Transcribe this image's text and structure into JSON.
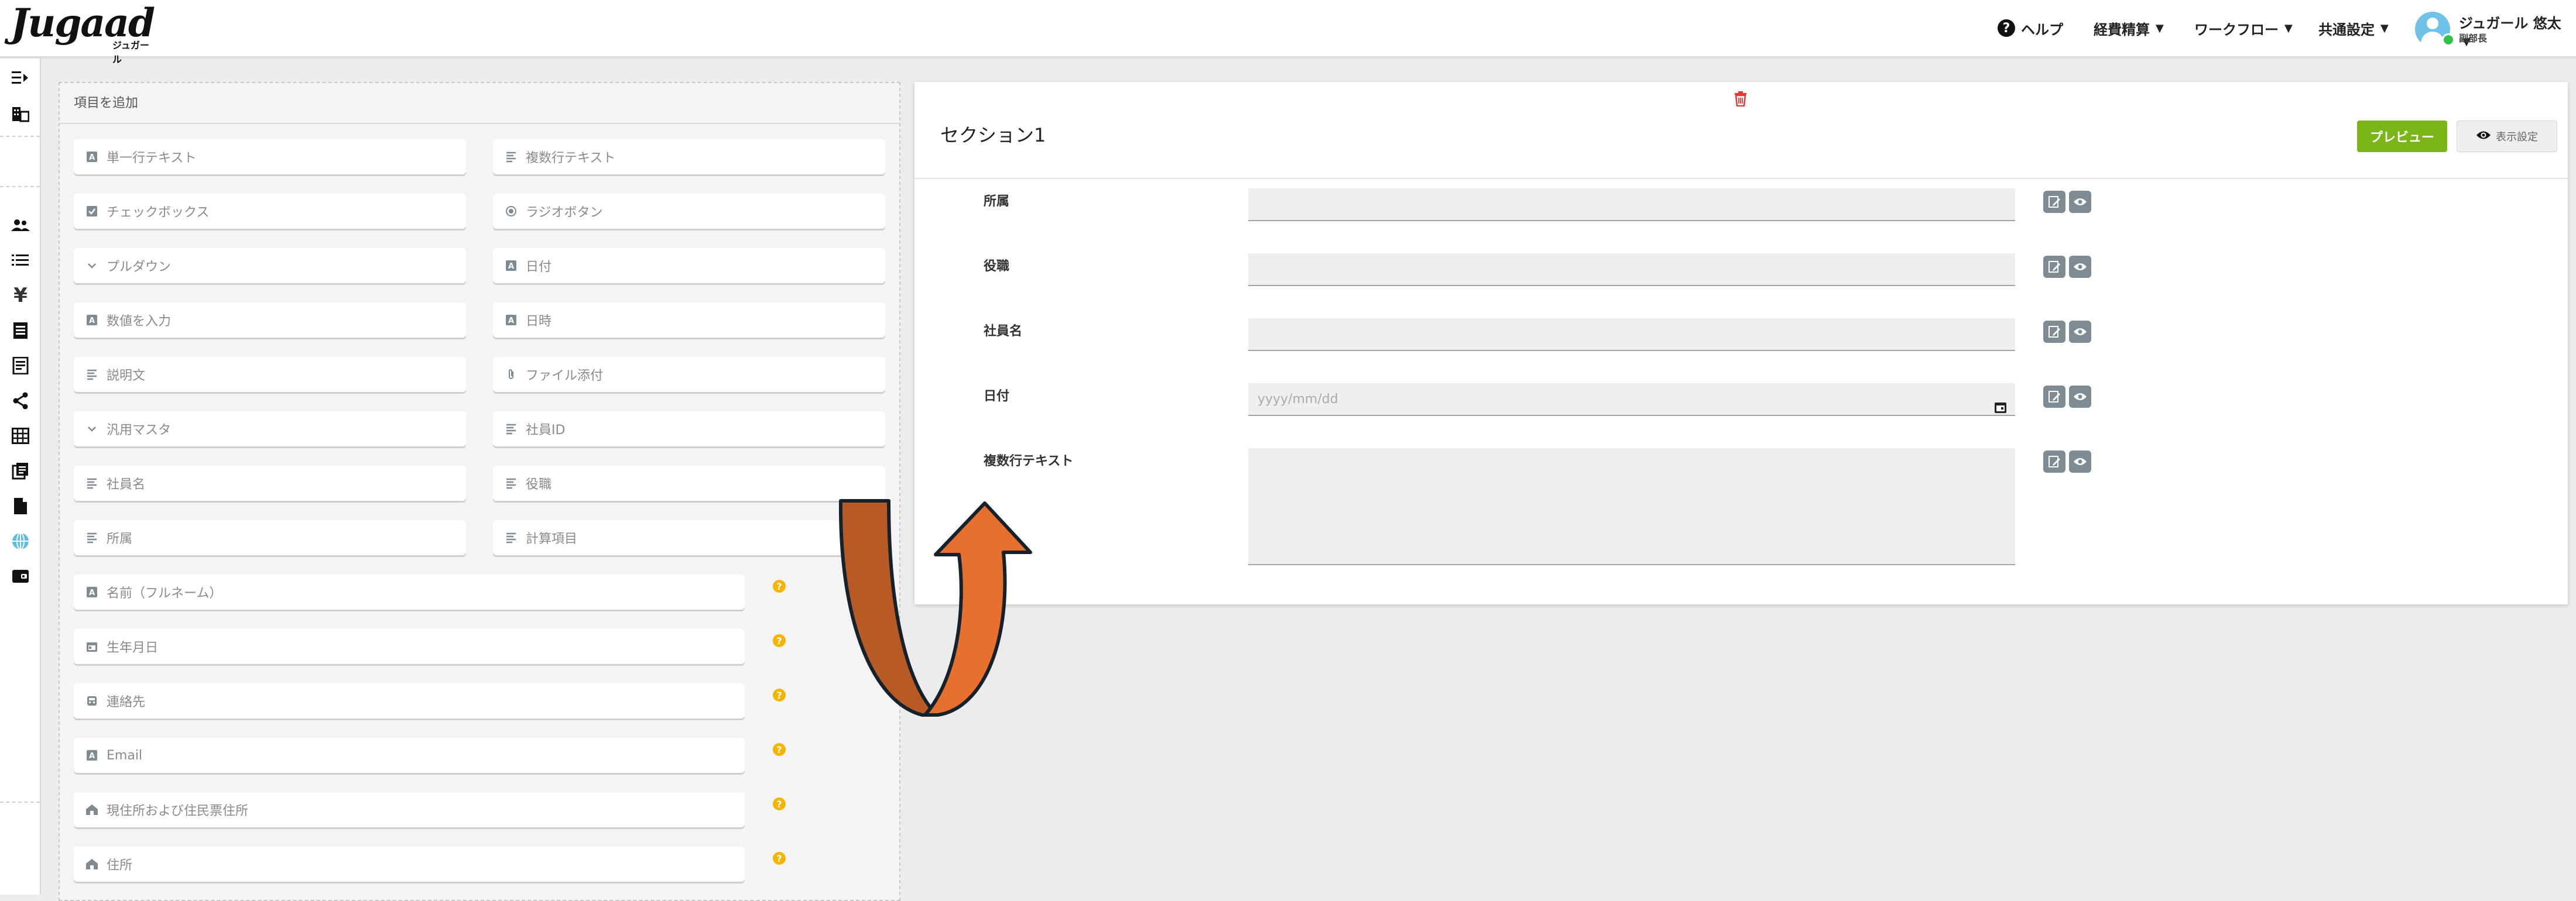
{
  "brand": {
    "logo": "Jugaad",
    "logo_sub": "ジュガール"
  },
  "header": {
    "help": "ヘルプ",
    "menus": [
      "経費精算",
      "ワークフロー",
      "共通設定"
    ],
    "user_name": "ジュガール 悠太",
    "user_role": "副部長"
  },
  "rail": {
    "icons": [
      "collapse-menu-icon",
      "building-icon",
      "users-icon",
      "list-icon",
      "yen-icon",
      "document-icon",
      "receipt-icon",
      "share-icon",
      "table-icon",
      "copy-icon",
      "file-icon",
      "globe-icon",
      "wallet-icon"
    ]
  },
  "palette": {
    "title": "項目を追加",
    "grid": [
      [
        "単一行テキスト",
        "複数行テキスト"
      ],
      [
        "チェックボックス",
        "ラジオボタン"
      ],
      [
        "プルダウン",
        "日付"
      ],
      [
        "数値を入力",
        "日時"
      ],
      [
        "説明文",
        "ファイル添付"
      ],
      [
        "汎用マスタ",
        "社員ID"
      ],
      [
        "社員名",
        "役職"
      ],
      [
        "所属",
        "計算項目"
      ]
    ],
    "wide": [
      "名前（フルネーム）",
      "生年月日",
      "連絡先",
      "Email",
      "現住所および住民票住所",
      "住所"
    ]
  },
  "form": {
    "section_title": "セクション1",
    "preview": "プレビュー",
    "display_settings": "表示設定",
    "fields": [
      "所属",
      "役職",
      "社員名",
      "日付",
      "複数行テキスト"
    ],
    "date_placeholder": "yyyy/mm/dd"
  },
  "colors": {
    "accent": "#7cb518",
    "help": "#f4b400",
    "arrow": "#e8702f",
    "arrow_dark": "#b85a26"
  }
}
